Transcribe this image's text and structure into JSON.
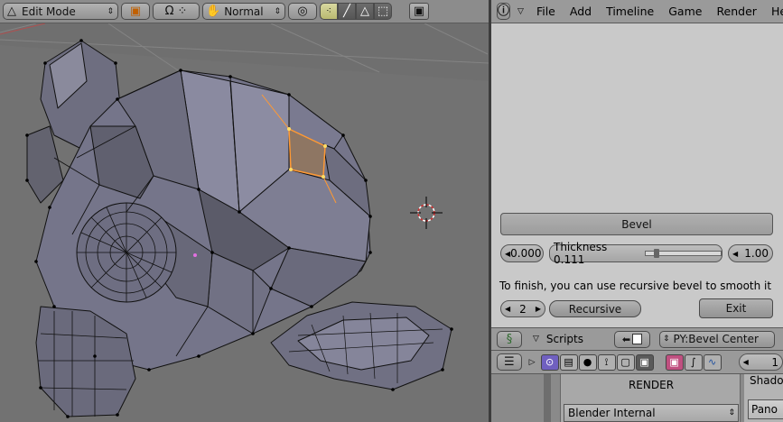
{
  "viewport_header": {
    "mode": "Edit Mode",
    "shading": "Normal"
  },
  "menubar": {
    "items": [
      "File",
      "Add",
      "Timeline",
      "Game",
      "Render",
      "Help"
    ]
  },
  "script_ui": {
    "bevel_label": "Bevel",
    "left_value": "0.000",
    "thickness_label": "Thickness 0.111",
    "thickness_fraction": 0.111,
    "right_value": "1.00",
    "hint": "To finish, you can use recursive bevel to smooth it",
    "recursive_count": "2",
    "recursive_label": "Recursive",
    "exit_label": "Exit"
  },
  "scripts_header": {
    "label": "Scripts",
    "script_name": "PY:Bevel Center"
  },
  "buttons_header": {
    "frame": "1"
  },
  "render_panel": {
    "title": "RENDER",
    "renderer": "Blender Internal"
  },
  "shadow_panel": {
    "tab": "Shado",
    "pano": "Pano"
  },
  "colors": {
    "selection": "#ff9933",
    "selected_face": "#8e7663",
    "mesh_face": "#7a7a8c"
  }
}
